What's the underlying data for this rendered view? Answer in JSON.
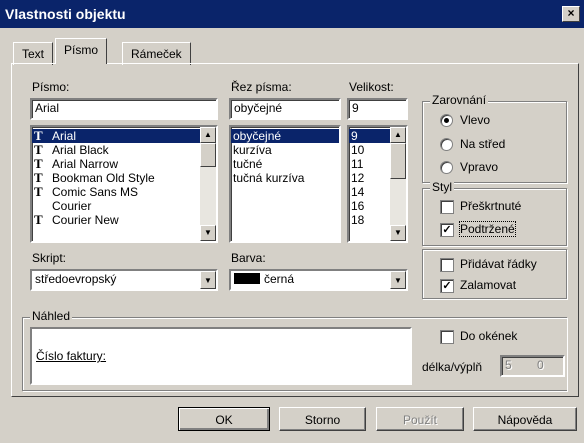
{
  "window": {
    "title": "Vlastnosti objektu",
    "close": "×"
  },
  "tabs": [
    {
      "label": "Text",
      "active": false
    },
    {
      "label": "Písmo",
      "active": true
    },
    {
      "label": "Rámeček",
      "active": false
    }
  ],
  "font": {
    "label": "Písmo:",
    "value": "Arial",
    "items": [
      "Arial",
      "Arial Black",
      "Arial Narrow",
      "Bookman Old Style",
      "Comic Sans MS",
      "Courier",
      "Courier New"
    ],
    "selected": "Arial",
    "truetype_flags": [
      true,
      true,
      true,
      true,
      true,
      false,
      true
    ]
  },
  "style": {
    "label": "Řez písma:",
    "value": "obyčejné",
    "items": [
      "obyčejné",
      "kurzíva",
      "tučné",
      "tučná kurzíva"
    ],
    "selected": "obyčejné"
  },
  "size": {
    "label": "Velikost:",
    "value": "9",
    "items": [
      "9",
      "10",
      "11",
      "12",
      "14",
      "16",
      "18"
    ],
    "selected": "9"
  },
  "script": {
    "label": "Skript:",
    "value": "středoevropský"
  },
  "color": {
    "label": "Barva:",
    "value": "černá",
    "swatch": "#000000"
  },
  "alignment": {
    "title": "Zarovnání",
    "options": [
      "Vlevo",
      "Na střed",
      "Vpravo"
    ],
    "selected": "Vlevo"
  },
  "styl": {
    "title": "Styl",
    "strikethrough": {
      "label": "Přeškrtnuté",
      "checked": false
    },
    "underline": {
      "label": "Podtržené",
      "checked": true
    }
  },
  "paragraph": {
    "add_lines": {
      "label": "Přidávat řádky",
      "checked": false
    },
    "wrap": {
      "label": "Zalamovat",
      "checked": true
    }
  },
  "preview": {
    "title": "Náhled",
    "text": "Číslo faktury:"
  },
  "boxes": {
    "label": "Do okének",
    "checked": false,
    "length_label": "délka/výplň",
    "length_value": "5",
    "fill_value": "0"
  },
  "buttons": {
    "ok": "OK",
    "cancel": "Storno",
    "apply": "Použít",
    "help": "Nápověda"
  },
  "colors": {
    "titlebar": "#0a246a",
    "face": "#d4d0c8",
    "selection": "#0a246a"
  }
}
